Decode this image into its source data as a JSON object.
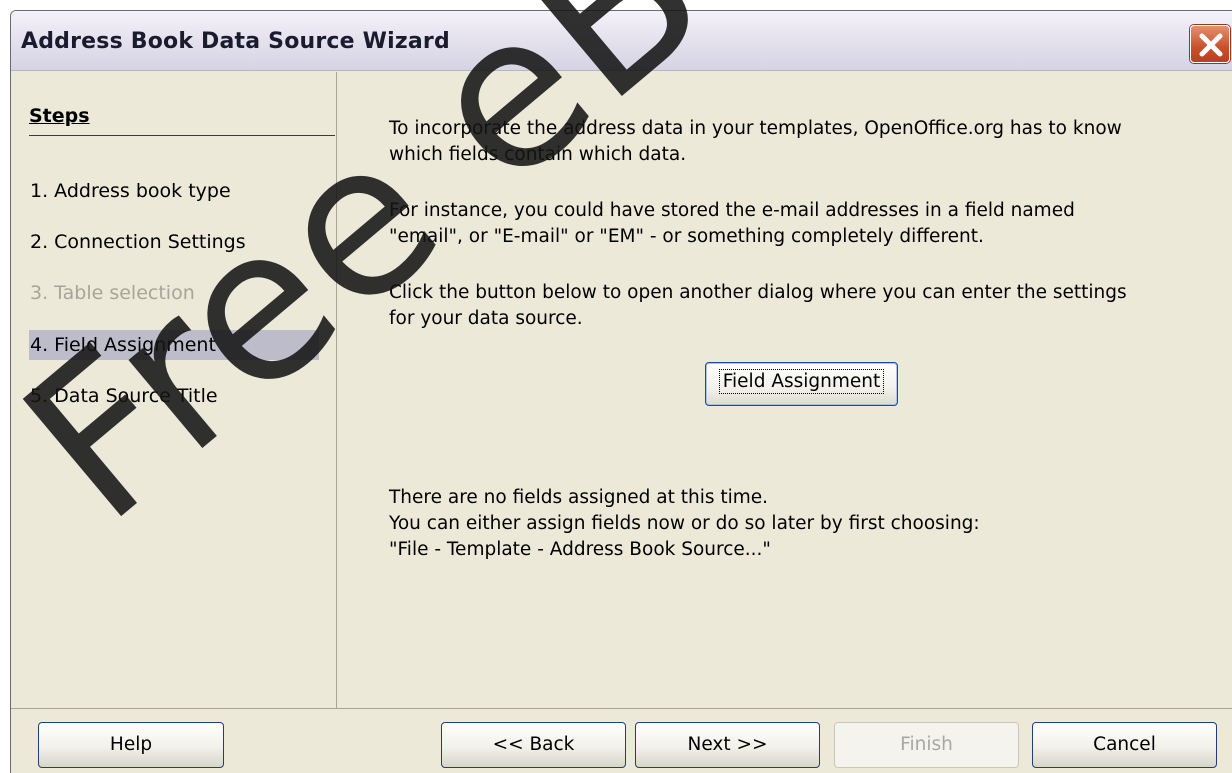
{
  "window": {
    "title": "Address Book Data Source Wizard"
  },
  "steps": {
    "heading": "Steps",
    "items": [
      {
        "label": "1. Address book type",
        "state": "normal"
      },
      {
        "label": "2. Connection Settings",
        "state": "normal"
      },
      {
        "label": "3. Table selection",
        "state": "disabled"
      },
      {
        "label": "4. Field Assignment",
        "state": "selected"
      },
      {
        "label": "5. Data Source Title",
        "state": "normal"
      }
    ]
  },
  "content": {
    "intro_line1": "To incorporate the address data in your templates, OpenOffice.org has to know",
    "intro_line2": "which fields contain which data.",
    "instance_line1": "For instance, you could have stored the e-mail addresses in a field named",
    "instance_line2": "\"email\", or \"E-mail\" or \"EM\" - or something completely different.",
    "click_line1": "Click the button below to open another dialog where you can enter the settings",
    "click_line2": "for your data source.",
    "field_button_label": "Field Assignment",
    "status_line1": "There are no fields assigned at this time.",
    "status_line2": "You can either assign fields now or do so later by first choosing:",
    "status_line3": "\"File - Template - Address Book Source...\""
  },
  "footer": {
    "help_label": "Help",
    "back_label": "<< Back",
    "next_label": "Next >>",
    "finish_label": "Finish",
    "cancel_label": "Cancel"
  },
  "watermark": {
    "text": "Free eBooks"
  },
  "colors": {
    "dialog_bg": "#ECE9D8",
    "selected_step_bg": "#BCBCCB",
    "disabled_text": "#A7A49A",
    "close_button": "#C8502B"
  }
}
